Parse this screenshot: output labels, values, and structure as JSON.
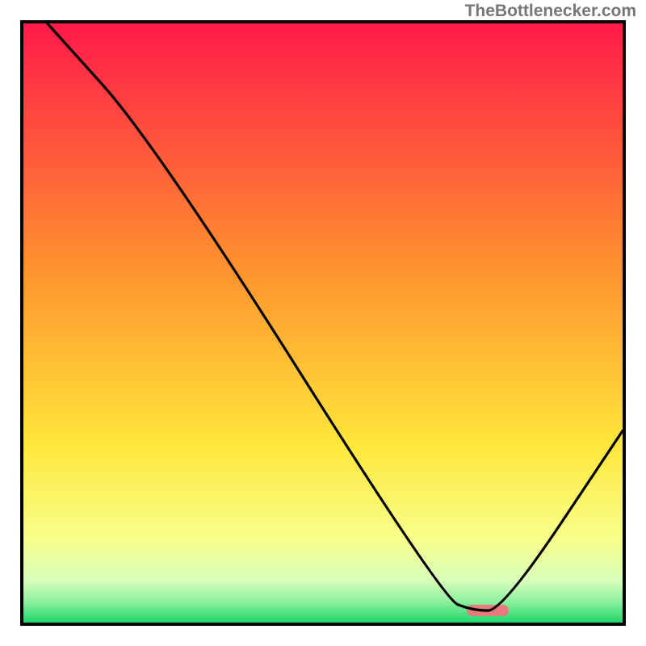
{
  "watermark": "TheBottlenecker.com",
  "chart_data": {
    "type": "line",
    "title": "",
    "xlabel": "",
    "ylabel": "",
    "xlim": [
      0,
      100
    ],
    "ylim": [
      0,
      100
    ],
    "background_gradient": {
      "top": "#ff1a4a",
      "mid1": "#ff8f2e",
      "mid2": "#ffe63a",
      "mid3": "#f8ff8a",
      "bottom": "#1ed66a"
    },
    "series": [
      {
        "name": "curve",
        "x": [
          4,
          22,
          70,
          75,
          80,
          100
        ],
        "y": [
          100,
          80,
          4,
          2,
          2,
          32
        ]
      }
    ],
    "marker": {
      "x": 77.5,
      "y": 2,
      "width_pct": 7,
      "height_pct": 1.8
    }
  }
}
